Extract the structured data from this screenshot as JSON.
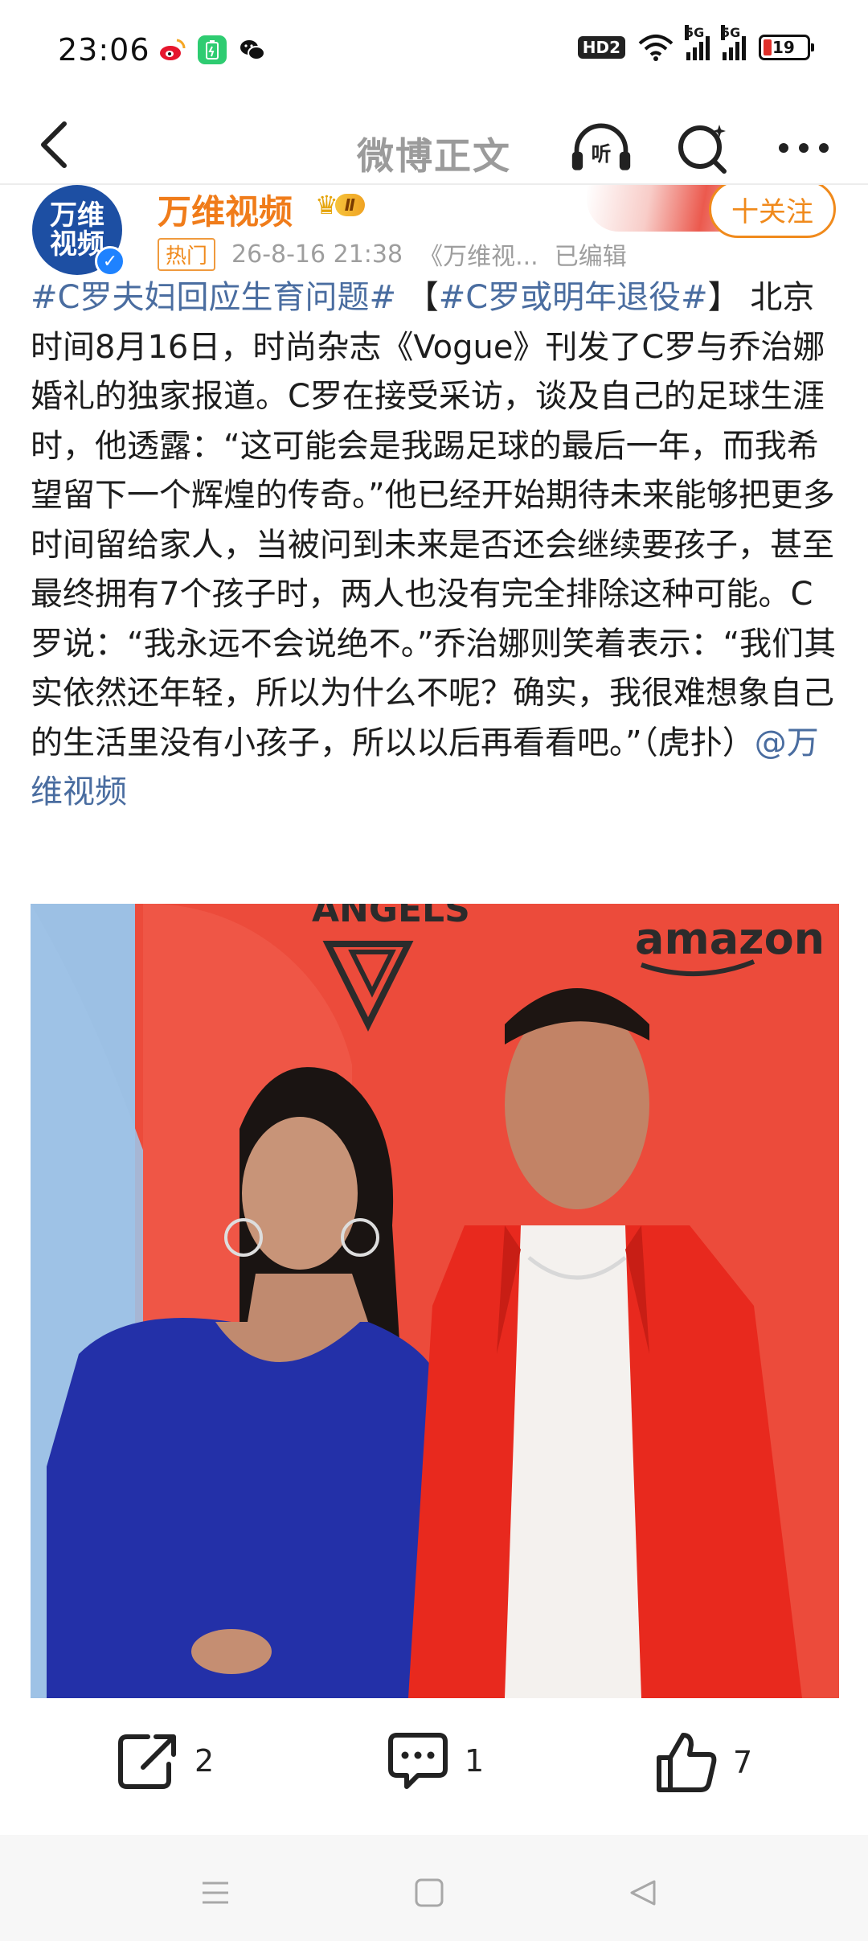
{
  "status_bar": {
    "time": "23:06",
    "apps": [
      "weibo-icon",
      "battery-saver-icon",
      "wechat-icon"
    ],
    "hd_label": "HD2",
    "network1": "5G",
    "network2": "5G",
    "battery_level": "19"
  },
  "nav": {
    "title": "微博正文"
  },
  "author": {
    "name": "万维视频",
    "avatar_line1": "万维",
    "avatar_line2": "视频",
    "vip_level": "Ⅱ",
    "hot_tag": "热门",
    "timestamp": "26-8-16 21:38",
    "source": "《万维视...",
    "edited": "已编辑",
    "follow_label": "十关注"
  },
  "post": {
    "hashtag1": "#C罗夫妇回应生育问题#",
    "hashtag2_open": "【",
    "hashtag2": "#C罗或明年退役#",
    "hashtag2_close": "】",
    "body": "北京时间8月16日，时尚杂志《Vogue》刊发了C罗与乔治娜婚礼的独家报道。C罗在接受采访，谈及自己的足球生涯时，他透露：“这可能会是我踢足球的最后一年，而我希望留下一个辉煌的传奇。”他已经开始期待未来能够把更多时间留给家人，当被问到未来是否还会继续要孩子，甚至最终拥有7个孩子时，两人也没有完全排除这种可能。C罗说：“我永远不会说绝不。”乔治娜则笑着表示：“我们其实依然还年轻，所以为什么不呢？确实，我很难想象自己的生活里没有小孩子，所以以后再看看吧。”（虎扑）",
    "mention": "@万维视频"
  },
  "photo": {
    "sign_text1": "ANGELS",
    "sign_text2": "amazon"
  },
  "actions": {
    "share_count": "2",
    "comment_count": "1",
    "like_count": "7"
  },
  "colors": {
    "hashtag": "#4a6da0",
    "accent_orange": "#f08a1c",
    "photo_bg": "#eb4a3a"
  }
}
